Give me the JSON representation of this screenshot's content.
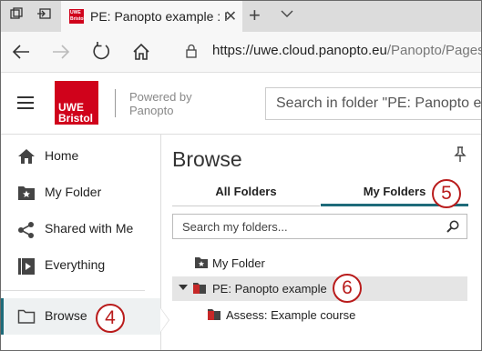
{
  "browser": {
    "tab_title": "PE: Panopto example : P",
    "favicon_text": "UWE Bristol",
    "url_main": "https://uwe.cloud.panopto.eu",
    "url_rest": "/Panopto/Pages/Sessi"
  },
  "header": {
    "logo_line1": "UWE",
    "logo_line2": "Bristol",
    "powered_line1": "Powered by",
    "powered_line2": "Panopto",
    "search_placeholder": "Search in folder \"PE: Panopto exampl"
  },
  "sidebar": {
    "items": [
      {
        "label": "Home",
        "icon": "home-icon"
      },
      {
        "label": "My Folder",
        "icon": "folder-star-icon"
      },
      {
        "label": "Shared with Me",
        "icon": "share-icon"
      },
      {
        "label": "Everything",
        "icon": "play-library-icon"
      },
      {
        "label": "Browse",
        "icon": "folder-outline-icon"
      }
    ]
  },
  "browse": {
    "title": "Browse",
    "tab_all": "All Folders",
    "tab_my": "My Folders",
    "search_placeholder": "Search my folders...",
    "tree": [
      {
        "label": "My Folder",
        "level": 0
      },
      {
        "label": "PE: Panopto example",
        "level": 0,
        "selected": true,
        "expanded": true
      },
      {
        "label": "Assess: Example course",
        "level": 1
      }
    ]
  },
  "callouts": {
    "browse": "4",
    "my_folders": "5",
    "folder": "6"
  },
  "colors": {
    "brand_red": "#d0021b",
    "accent_teal": "#1e6b7a",
    "callout_red": "#b91c1c"
  }
}
